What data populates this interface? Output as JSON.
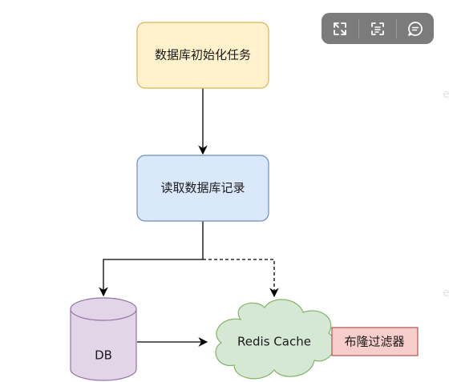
{
  "nodes": {
    "init_task": {
      "label": "数据库初始化任务",
      "fill": "#fff2cc",
      "stroke": "#d6b656"
    },
    "read_records": {
      "label": "读取数据库记录",
      "fill": "#dae8fc",
      "stroke": "#6c8ebf"
    },
    "db": {
      "label": "DB",
      "fill": "#e1d5e7",
      "stroke": "#9673a6"
    },
    "redis_cache": {
      "label": "Redis Cache",
      "fill": "#d5e8d4",
      "stroke": "#82b366"
    },
    "bloom_filter": {
      "label": "布隆过滤器",
      "fill": "#f8cecc",
      "stroke": "#b85450"
    }
  },
  "edges": [
    {
      "from": "init_task",
      "to": "read_records",
      "style": "solid"
    },
    {
      "from": "read_records",
      "to": "db",
      "style": "solid"
    },
    {
      "from": "read_records",
      "to": "redis_cache",
      "style": "dashed"
    },
    {
      "from": "db",
      "to": "redis_cache",
      "style": "solid"
    }
  ],
  "toolbar": {
    "background": "#7b7b7b",
    "buttons": [
      {
        "icon": "fullscreen-icon"
      },
      {
        "icon": "scan-text-icon"
      },
      {
        "icon": "comment-icon"
      }
    ]
  },
  "watermark": {
    "text": "e"
  }
}
